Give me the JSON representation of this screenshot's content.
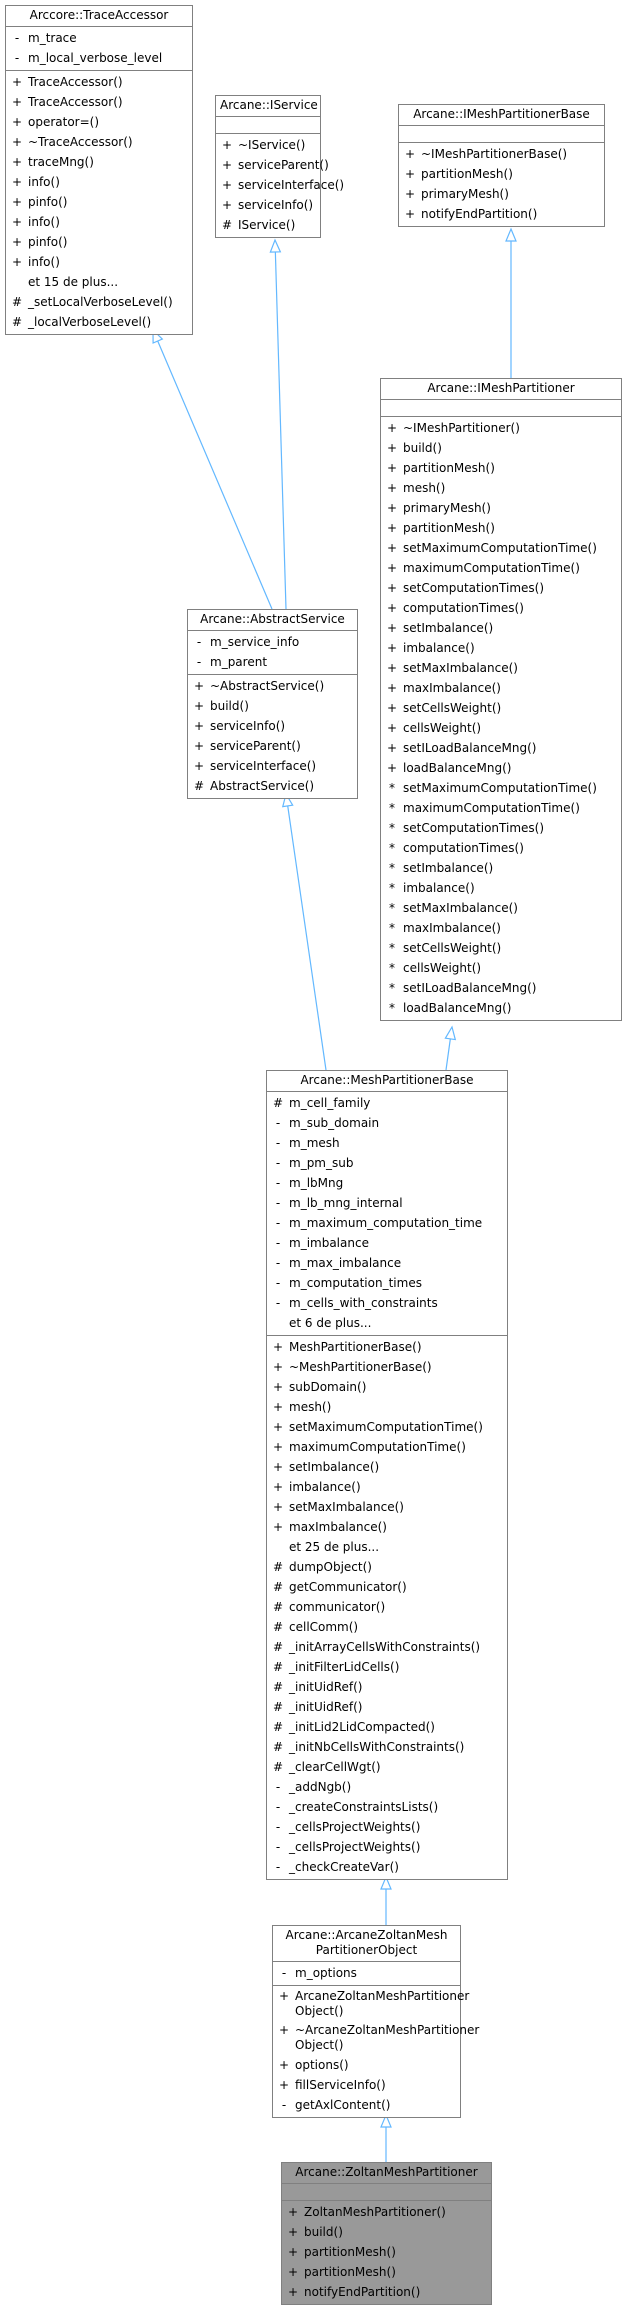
{
  "colors": {
    "edge": "#63b8ff",
    "border": "#808080",
    "current_bg": "#999999"
  },
  "classes": {
    "trace_accessor": {
      "title": "Arccore::TraceAccessor",
      "attributes": [
        {
          "vis": "-",
          "name": "m_trace"
        },
        {
          "vis": "-",
          "name": "m_local_verbose_level"
        }
      ],
      "methods": [
        {
          "vis": "+",
          "name": "TraceAccessor()"
        },
        {
          "vis": "+",
          "name": "TraceAccessor()"
        },
        {
          "vis": "+",
          "name": "operator=()"
        },
        {
          "vis": "+",
          "name": "~TraceAccessor()"
        },
        {
          "vis": "+",
          "name": "traceMng()"
        },
        {
          "vis": "+",
          "name": "info()"
        },
        {
          "vis": "+",
          "name": "pinfo()"
        },
        {
          "vis": "+",
          "name": "info()"
        },
        {
          "vis": "+",
          "name": "pinfo()"
        },
        {
          "vis": "+",
          "name": "info()"
        },
        {
          "vis": "",
          "name": "et 15 de plus..."
        },
        {
          "vis": "#",
          "name": "_setLocalVerboseLevel()"
        },
        {
          "vis": "#",
          "name": "_localVerboseLevel()"
        }
      ]
    },
    "iservice": {
      "title": "Arcane::IService",
      "attributes": [],
      "methods": [
        {
          "vis": "+",
          "name": "~IService()"
        },
        {
          "vis": "+",
          "name": "serviceParent()"
        },
        {
          "vis": "+",
          "name": "serviceInterface()"
        },
        {
          "vis": "+",
          "name": "serviceInfo()"
        },
        {
          "vis": "#",
          "name": "IService()"
        }
      ]
    },
    "imesh_partitioner_base": {
      "title": "Arcane::IMeshPartitionerBase",
      "attributes": [],
      "methods": [
        {
          "vis": "+",
          "name": "~IMeshPartitionerBase()"
        },
        {
          "vis": "+",
          "name": "partitionMesh()"
        },
        {
          "vis": "+",
          "name": "primaryMesh()"
        },
        {
          "vis": "+",
          "name": "notifyEndPartition()"
        }
      ]
    },
    "imesh_partitioner": {
      "title": "Arcane::IMeshPartitioner",
      "attributes": [],
      "methods": [
        {
          "vis": "+",
          "name": "~IMeshPartitioner()"
        },
        {
          "vis": "+",
          "name": "build()"
        },
        {
          "vis": "+",
          "name": "partitionMesh()"
        },
        {
          "vis": "+",
          "name": "mesh()"
        },
        {
          "vis": "+",
          "name": "primaryMesh()"
        },
        {
          "vis": "+",
          "name": "partitionMesh()"
        },
        {
          "vis": "+",
          "name": "setMaximumComputationTime()"
        },
        {
          "vis": "+",
          "name": "maximumComputationTime()"
        },
        {
          "vis": "+",
          "name": "setComputationTimes()"
        },
        {
          "vis": "+",
          "name": "computationTimes()"
        },
        {
          "vis": "+",
          "name": "setImbalance()"
        },
        {
          "vis": "+",
          "name": "imbalance()"
        },
        {
          "vis": "+",
          "name": "setMaxImbalance()"
        },
        {
          "vis": "+",
          "name": "maxImbalance()"
        },
        {
          "vis": "+",
          "name": "setCellsWeight()"
        },
        {
          "vis": "+",
          "name": "cellsWeight()"
        },
        {
          "vis": "+",
          "name": "setILoadBalanceMng()"
        },
        {
          "vis": "+",
          "name": "loadBalanceMng()"
        },
        {
          "vis": "*",
          "name": "setMaximumComputationTime()"
        },
        {
          "vis": "*",
          "name": "maximumComputationTime()"
        },
        {
          "vis": "*",
          "name": "setComputationTimes()"
        },
        {
          "vis": "*",
          "name": "computationTimes()"
        },
        {
          "vis": "*",
          "name": "setImbalance()"
        },
        {
          "vis": "*",
          "name": "imbalance()"
        },
        {
          "vis": "*",
          "name": "setMaxImbalance()"
        },
        {
          "vis": "*",
          "name": "maxImbalance()"
        },
        {
          "vis": "*",
          "name": "setCellsWeight()"
        },
        {
          "vis": "*",
          "name": "cellsWeight()"
        },
        {
          "vis": "*",
          "name": "setILoadBalanceMng()"
        },
        {
          "vis": "*",
          "name": "loadBalanceMng()"
        }
      ]
    },
    "abstract_service": {
      "title": "Arcane::AbstractService",
      "attributes": [
        {
          "vis": "-",
          "name": "m_service_info"
        },
        {
          "vis": "-",
          "name": "m_parent"
        }
      ],
      "methods": [
        {
          "vis": "+",
          "name": "~AbstractService()"
        },
        {
          "vis": "+",
          "name": "build()"
        },
        {
          "vis": "+",
          "name": "serviceInfo()"
        },
        {
          "vis": "+",
          "name": "serviceParent()"
        },
        {
          "vis": "+",
          "name": "serviceInterface()"
        },
        {
          "vis": "#",
          "name": "AbstractService()"
        }
      ]
    },
    "mesh_partitioner_base": {
      "title": "Arcane::MeshPartitionerBase",
      "attributes": [
        {
          "vis": "#",
          "name": "m_cell_family"
        },
        {
          "vis": "-",
          "name": "m_sub_domain"
        },
        {
          "vis": "-",
          "name": "m_mesh"
        },
        {
          "vis": "-",
          "name": "m_pm_sub"
        },
        {
          "vis": "-",
          "name": "m_lbMng"
        },
        {
          "vis": "-",
          "name": "m_lb_mng_internal"
        },
        {
          "vis": "-",
          "name": "m_maximum_computation_time"
        },
        {
          "vis": "-",
          "name": "m_imbalance"
        },
        {
          "vis": "-",
          "name": "m_max_imbalance"
        },
        {
          "vis": "-",
          "name": "m_computation_times"
        },
        {
          "vis": "-",
          "name": "m_cells_with_constraints"
        },
        {
          "vis": "",
          "name": "et 6 de plus..."
        }
      ],
      "methods": [
        {
          "vis": "+",
          "name": "MeshPartitionerBase()"
        },
        {
          "vis": "+",
          "name": "~MeshPartitionerBase()"
        },
        {
          "vis": "+",
          "name": "subDomain()"
        },
        {
          "vis": "+",
          "name": "mesh()"
        },
        {
          "vis": "+",
          "name": "setMaximumComputationTime()"
        },
        {
          "vis": "+",
          "name": "maximumComputationTime()"
        },
        {
          "vis": "+",
          "name": "setImbalance()"
        },
        {
          "vis": "+",
          "name": "imbalance()"
        },
        {
          "vis": "+",
          "name": "setMaxImbalance()"
        },
        {
          "vis": "+",
          "name": "maxImbalance()"
        },
        {
          "vis": "",
          "name": "et 25 de plus..."
        },
        {
          "vis": "#",
          "name": "dumpObject()"
        },
        {
          "vis": "#",
          "name": "getCommunicator()"
        },
        {
          "vis": "#",
          "name": "communicator()"
        },
        {
          "vis": "#",
          "name": "cellComm()"
        },
        {
          "vis": "#",
          "name": "_initArrayCellsWithConstraints()"
        },
        {
          "vis": "#",
          "name": "_initFilterLidCells()"
        },
        {
          "vis": "#",
          "name": "_initUidRef()"
        },
        {
          "vis": "#",
          "name": "_initUidRef()"
        },
        {
          "vis": "#",
          "name": "_initLid2LidCompacted()"
        },
        {
          "vis": "#",
          "name": "_initNbCellsWithConstraints()"
        },
        {
          "vis": "#",
          "name": "_clearCellWgt()"
        },
        {
          "vis": "-",
          "name": "_addNgb()"
        },
        {
          "vis": "-",
          "name": "_createConstraintsLists()"
        },
        {
          "vis": "-",
          "name": "_cellsProjectWeights()"
        },
        {
          "vis": "-",
          "name": "_cellsProjectWeights()"
        },
        {
          "vis": "-",
          "name": "_checkCreateVar()"
        }
      ]
    },
    "arcane_zoltan_object": {
      "title": "Arcane::ArcaneZoltanMesh\nPartitionerObject",
      "attributes": [
        {
          "vis": "-",
          "name": "m_options"
        }
      ],
      "methods": [
        {
          "vis": "+",
          "name": "ArcaneZoltanMeshPartitioner Object()",
          "wrap": true
        },
        {
          "vis": "+",
          "name": "~ArcaneZoltanMeshPartitioner Object()",
          "wrap": true
        },
        {
          "vis": "+",
          "name": "options()"
        },
        {
          "vis": "+",
          "name": "fillServiceInfo()"
        },
        {
          "vis": "-",
          "name": "getAxlContent()"
        }
      ]
    },
    "zoltan_mesh_partitioner": {
      "title": "Arcane::ZoltanMeshPartitioner",
      "attributes": [],
      "methods": [
        {
          "vis": "+",
          "name": "ZoltanMeshPartitioner()"
        },
        {
          "vis": "+",
          "name": "build()"
        },
        {
          "vis": "+",
          "name": "partitionMesh()"
        },
        {
          "vis": "+",
          "name": "partitionMesh()"
        },
        {
          "vis": "+",
          "name": "notifyEndPartition()"
        }
      ]
    }
  },
  "edges": [
    {
      "from": "abstract_service",
      "to": "trace_accessor",
      "type": "inheritance"
    },
    {
      "from": "abstract_service",
      "to": "iservice",
      "type": "inheritance"
    },
    {
      "from": "imesh_partitioner",
      "to": "imesh_partitioner_base",
      "type": "inheritance"
    },
    {
      "from": "mesh_partitioner_base",
      "to": "abstract_service",
      "type": "inheritance"
    },
    {
      "from": "mesh_partitioner_base",
      "to": "imesh_partitioner",
      "type": "inheritance"
    },
    {
      "from": "arcane_zoltan_object",
      "to": "mesh_partitioner_base",
      "type": "inheritance"
    },
    {
      "from": "zoltan_mesh_partitioner",
      "to": "arcane_zoltan_object",
      "type": "inheritance"
    }
  ]
}
